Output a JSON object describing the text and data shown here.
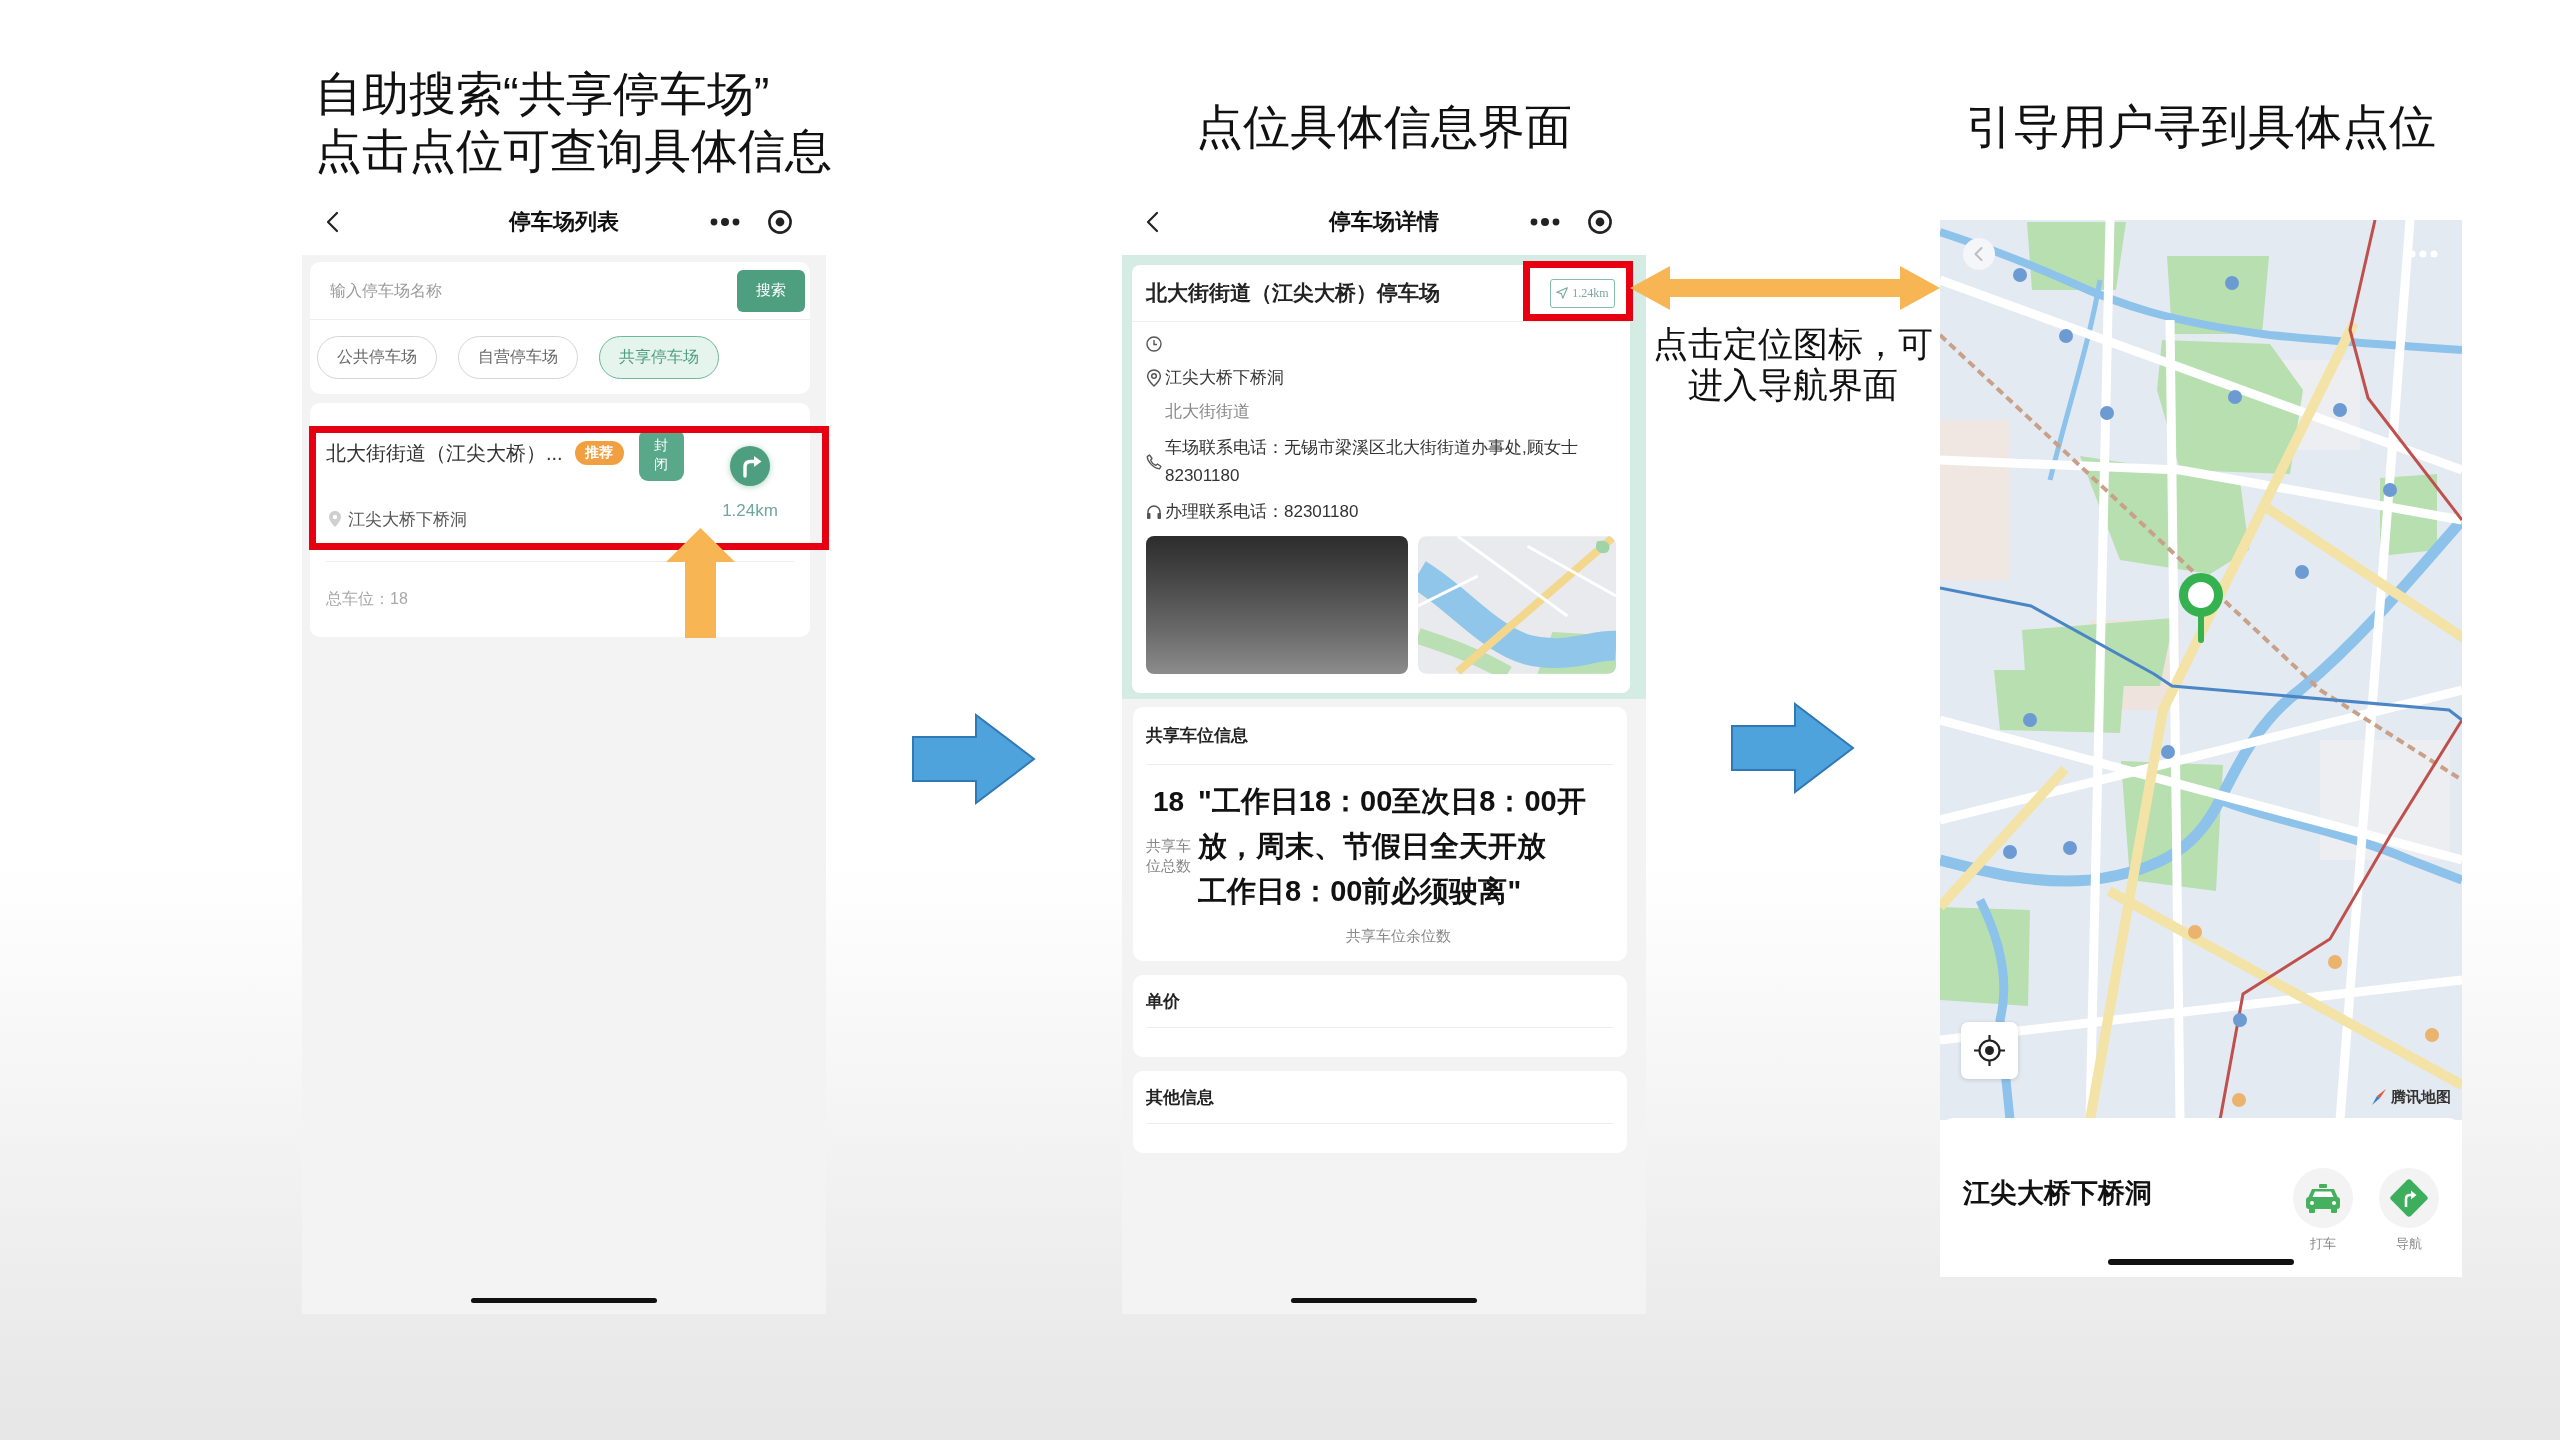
{
  "list_screen": {
    "caption": "自助搜索“共享停车场”\n点击点位可查询具体信息",
    "title": "停车场列表",
    "search": {
      "placeholder": "输入停车场名称",
      "button": "搜索"
    },
    "filters": [
      {
        "label": "公共停车场",
        "selected": false
      },
      {
        "label": "自营停车场",
        "selected": false
      },
      {
        "label": "共享停车场",
        "selected": true
      }
    ],
    "results": [
      {
        "name": "北大街街道（江尖大桥）...",
        "badge": "推荐",
        "status": "封闭",
        "distance": "1.24km",
        "address": "江尖大桥下桥洞",
        "highlighted": true,
        "total": "总车位：18"
      }
    ]
  },
  "detail_screen": {
    "caption": "点位具体信息界面",
    "title": "停车场详情",
    "name": "北大街街道（江尖大桥）停车场",
    "distance": "1.24km",
    "distance_highlighted": true,
    "info_rows": [
      {
        "kind": "hours"
      },
      {
        "kind": "address",
        "text": "江尖大桥下桥洞",
        "detail": "北大街街道"
      },
      {
        "kind": "phone",
        "text": "车场联系电话：无锡市梁溪区北大街街道办事处,顾女士82301180"
      },
      {
        "kind": "service",
        "text": "办理联系电话：82301180"
      }
    ],
    "sections": [
      {
        "kind": "shared",
        "title": "共享车位信息",
        "total": "18",
        "total_label": "共享车位总数",
        "hours": [
          "\"工作日18：00至次日8：00开放，周末、节假日全天开放",
          "工作日8：00前必须驶离\""
        ],
        "remaining_label": "共享车位余位数"
      },
      {
        "kind": "plain",
        "title": "单价"
      },
      {
        "kind": "plain",
        "title": "其他信息"
      }
    ]
  },
  "annotation": "点击定位图标，可进入导航界面",
  "map_screen": {
    "caption": "引导用户寻到具体点位",
    "attribution": "腾讯地图",
    "place": "江尖大桥下桥洞",
    "actions": [
      {
        "kind": "taxi",
        "label": "打车"
      },
      {
        "kind": "navigate",
        "label": "导航"
      }
    ]
  }
}
